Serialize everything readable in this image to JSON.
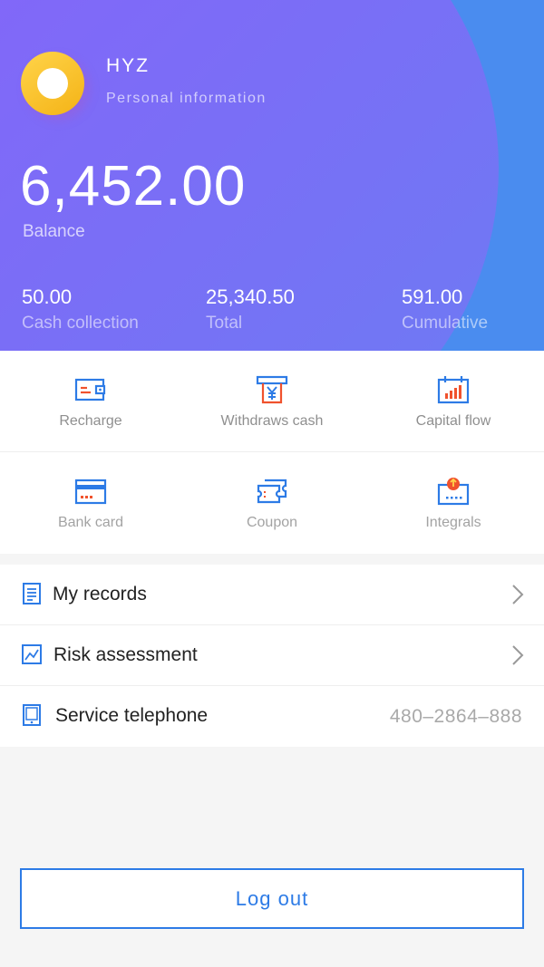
{
  "profile": {
    "name": "HYZ",
    "subtitle": "Personal information"
  },
  "balance": {
    "value": "6,452.00",
    "label": "Balance"
  },
  "stats": [
    {
      "value": "50.00",
      "label": "Cash collection"
    },
    {
      "value": "25,340.50",
      "label": "Total"
    },
    {
      "value": "591.00",
      "label": "Cumulative"
    }
  ],
  "actions": [
    {
      "label": "Recharge",
      "icon": "wallet-icon"
    },
    {
      "label": "Withdraws cash",
      "icon": "atm-yen-icon"
    },
    {
      "label": "Capital flow",
      "icon": "calendar-chart-icon"
    },
    {
      "label": "Bank card",
      "icon": "bank-card-icon"
    },
    {
      "label": "Coupon",
      "icon": "coupon-icon"
    },
    {
      "label": "Integrals",
      "icon": "points-icon"
    }
  ],
  "menu": [
    {
      "label": "My records",
      "icon": "document-icon"
    },
    {
      "label": "Risk assessment",
      "icon": "chart-icon"
    },
    {
      "label": "Service telephone",
      "icon": "tablet-icon",
      "value": "480–2864–888"
    }
  ],
  "logout_label": "Log out",
  "colors": {
    "accent": "#2d7be6",
    "header_purple": "#7a64f7",
    "header_blue": "#4a8cef",
    "icon_orange": "#f0522d",
    "avatar_yellow": "#f9c22a"
  }
}
